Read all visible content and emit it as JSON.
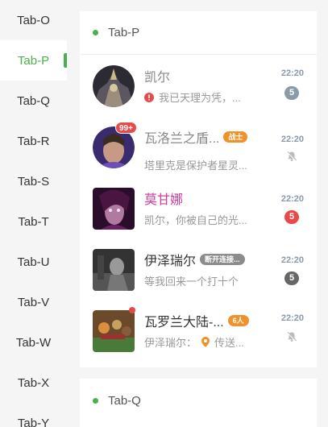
{
  "sidebar": {
    "tabs": [
      {
        "label": "Tab-O"
      },
      {
        "label": "Tab-P",
        "active": true
      },
      {
        "label": "Tab-Q"
      },
      {
        "label": "Tab-R"
      },
      {
        "label": "Tab-S"
      },
      {
        "label": "Tab-T"
      },
      {
        "label": "Tab-U"
      },
      {
        "label": "Tab-V"
      },
      {
        "label": "Tab-W"
      },
      {
        "label": "Tab-X"
      },
      {
        "label": "Tab-Y"
      }
    ]
  },
  "sections": [
    {
      "title": "Tab-P",
      "conversations": [
        {
          "name": "凯尔",
          "preview": "我已天理为凭，...",
          "time": "22:20",
          "unread": "5",
          "preview_icon": "error-icon"
        },
        {
          "name": "瓦洛兰之盾...",
          "tag": "战士",
          "preview": "塔里克是保护者星灵...",
          "time": "22:20",
          "avatar_badge": "99+",
          "muted": true
        },
        {
          "name": "莫甘娜",
          "preview": "凯尔，你被自己的光...",
          "time": "22:20",
          "unread": "5"
        },
        {
          "name": "伊泽瑞尔",
          "tag": "断开连接...",
          "preview": "等我回来一个打十个",
          "time": "22:20",
          "unread": "5"
        },
        {
          "name": "瓦罗兰大陆-...",
          "tag": "6人",
          "preview": "伊泽瑞尔：",
          "preview_tail": "传送...",
          "time": "22:20",
          "muted": true,
          "preview_icon": "location-icon"
        }
      ]
    },
    {
      "title": "Tab-Q"
    }
  ],
  "colors": {
    "accent": "#4cae4c",
    "badge_red": "#e84a4a",
    "tag_orange": "#f0922b",
    "name_pink": "#d13e9e"
  }
}
